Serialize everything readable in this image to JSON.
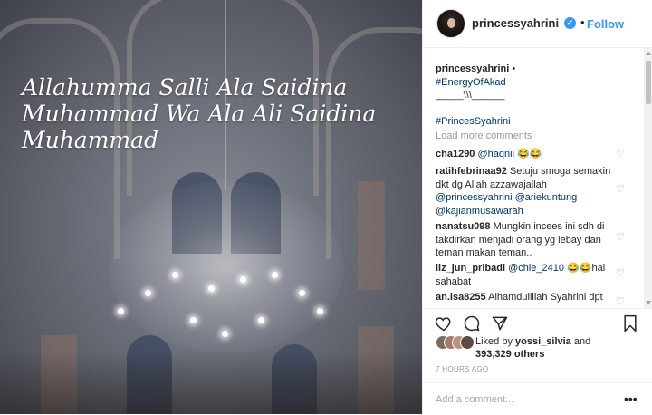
{
  "post": {
    "image_caption_lines": [
      "Allahumma Salli Ala Saidina",
      "Muhammad  Wa Ala Ali Saidina",
      "Muhammad"
    ]
  },
  "header": {
    "username": "princessyahrini",
    "separator": "•",
    "follow_label": "Follow",
    "verified_icon": "verified-badge-icon"
  },
  "caption": {
    "username": "princessyahrini",
    "separator": " •",
    "hashtag1": "#EnergyOfAkad",
    "line2": "_____\\\\\\______",
    "hashtag2": "#PrincesSyahrini"
  },
  "load_more_label": "Load more comments",
  "comments": [
    {
      "user": "cha1290",
      "mention": "@haqnii",
      "text": " 😂😂"
    },
    {
      "user": "ratihfebrinaa92",
      "text": " Setuju smoga semakin dkt dg Allah azzawajallah",
      "mentions": "@princessyahrini @ariekuntung @kajianmusawarah"
    },
    {
      "user": "nanatsu098",
      "text": " Mungkin incees ini sdh di takdirkan menjadi orang yg lebay dan teman makan teman.."
    },
    {
      "user": "liz_jun_pribadi",
      "mention": "@chie_2410",
      "text": " 😂😂hai sahabat"
    },
    {
      "user": "an.isa8255",
      "text": " Alhamdulillah Syahrini dpt"
    }
  ],
  "likes": {
    "liked_by_prefix": "Liked by ",
    "liked_by_user": "yossi_silvia",
    "and": " and",
    "others": "393,329 others"
  },
  "timestamp": "7 HOURS AGO",
  "add_comment_placeholder": "Add a comment...",
  "more_options": "•••",
  "colors": {
    "accent": "#3897f0",
    "link": "#003569",
    "muted": "#999999"
  }
}
